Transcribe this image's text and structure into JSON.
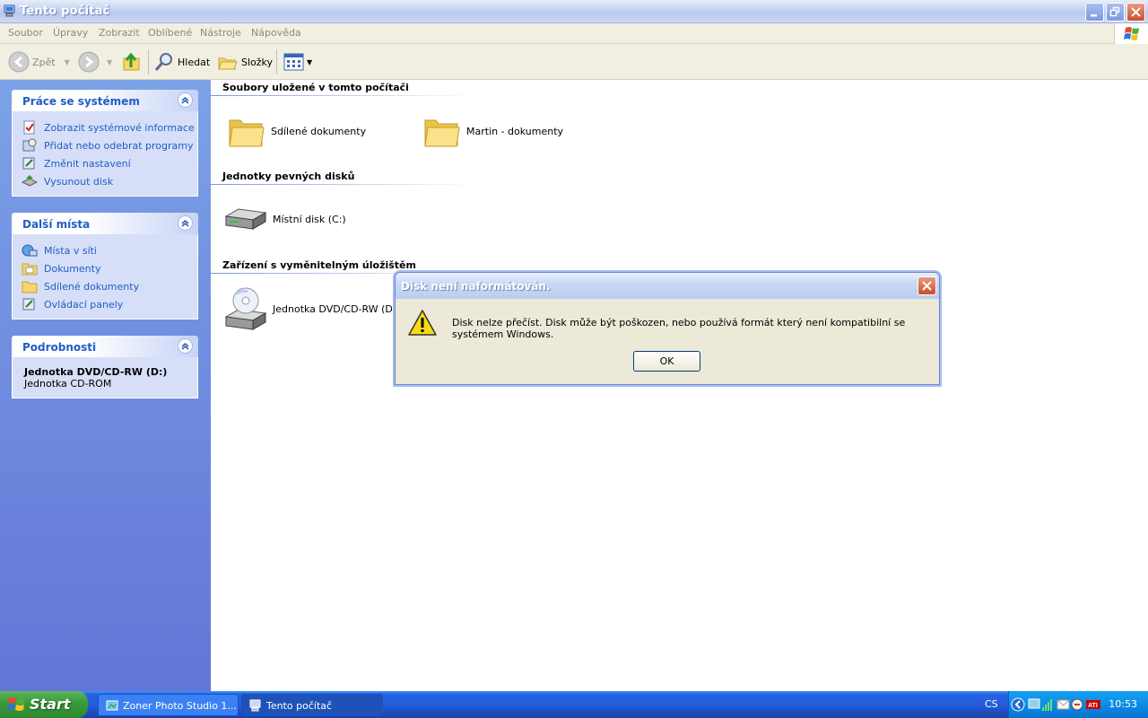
{
  "window": {
    "title": "Tento počítač"
  },
  "menu": [
    "Soubor",
    "Úpravy",
    "Zobrazit",
    "Oblíbené",
    "Nástroje",
    "Nápověda"
  ],
  "toolbar": {
    "back": "Zpět",
    "search": "Hledat",
    "folders": "Složky"
  },
  "sidebar": {
    "system_tasks": {
      "title": "Práce se systémem",
      "items": [
        "Zobrazit systémové informace",
        "Přidat nebo odebrat programy",
        "Změnit nastavení",
        "Vysunout disk"
      ]
    },
    "other_places": {
      "title": "Další místa",
      "items": [
        "Místa v síti",
        "Dokumenty",
        "Sdílené dokumenty",
        "Ovládací panely"
      ]
    },
    "details": {
      "title": "Podrobnosti",
      "name": "Jednotka DVD/CD-RW (D:)",
      "type": "Jednotka CD-ROM"
    }
  },
  "content": {
    "groups": [
      {
        "title": "Soubory uložené v tomto počítači",
        "items": [
          "Sdílené dokumenty",
          "Martin - dokumenty"
        ]
      },
      {
        "title": "Jednotky pevných disků",
        "items": [
          "Místní disk (C:)"
        ]
      },
      {
        "title": "Zařízení s vyměnitelným úložištěm",
        "items": [
          "Jednotka DVD/CD-RW (D:)"
        ]
      }
    ]
  },
  "dialog": {
    "title": "Disk není naformátován.",
    "message": "Disk nelze přečíst. Disk může být poškozen, nebo používá formát který není kompatibilní se systémem Windows.",
    "ok": "OK"
  },
  "taskbar": {
    "start": "Start",
    "tasks": [
      "Zoner Photo Studio 1...",
      "Tento počítač"
    ],
    "language": "CS",
    "clock": "10:53"
  }
}
